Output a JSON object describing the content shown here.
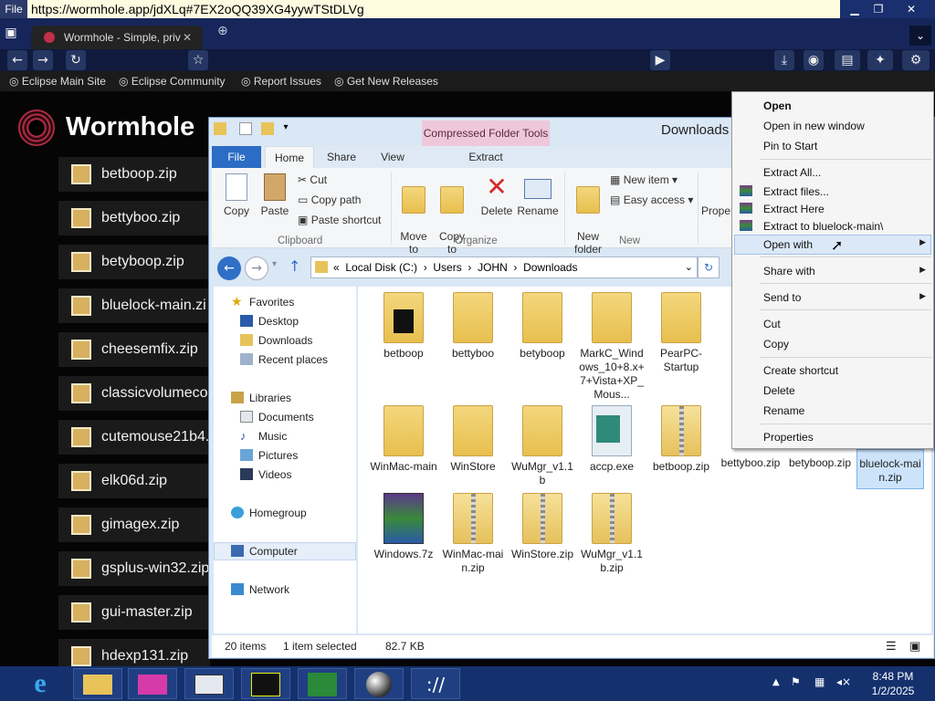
{
  "browser": {
    "file_menu": "File",
    "url": "https://wormhole.app/jdXLq#7EX2oQQ39XG4yywTStDLVg",
    "tab_title": "Wormhole - Simple, priv",
    "bookmarks": [
      "Eclipse Main Site",
      "Eclipse Community",
      "Report Issues",
      "Get New Releases"
    ]
  },
  "page": {
    "site_title": "Wormhole",
    "files": [
      "betboop.zip",
      "bettyboo.zip",
      "betyboop.zip",
      "bluelock-main.zi",
      "cheesemfix.zip",
      "classicvolumeco",
      "cutemouse21b4.",
      "elk06d.zip",
      "gimagex.zip",
      "gsplus-win32.zip",
      "gui-master.zip",
      "hdexp131.zip"
    ]
  },
  "explorer": {
    "title": "Downloads",
    "context_tab": "Compressed Folder Tools",
    "tabs": [
      "File",
      "Home",
      "Share",
      "View",
      "Extract"
    ],
    "ribbon": {
      "copy": "Copy",
      "paste": "Paste",
      "cut": "Cut",
      "copy_path": "Copy path",
      "paste_shortcut": "Paste shortcut",
      "clipboard": "Clipboard",
      "move_to": "Move\nto",
      "copy_to": "Copy\nto",
      "delete": "Delete",
      "rename": "Rename",
      "organize": "Organize",
      "new_folder": "New\nfolder",
      "new_item": "New item",
      "easy_access": "Easy access",
      "new": "New",
      "properties": "Prope"
    },
    "address": {
      "chevron": "«",
      "parts": [
        "Local Disk (C:)",
        "Users",
        "JOHN",
        "Downloads"
      ]
    },
    "nav": {
      "favorites": "Favorites",
      "favorites_items": [
        "Desktop",
        "Downloads",
        "Recent places"
      ],
      "libraries": "Libraries",
      "libraries_items": [
        "Documents",
        "Music",
        "Pictures",
        "Videos"
      ],
      "homegroup": "Homegroup",
      "computer": "Computer",
      "network": "Network"
    },
    "items": [
      {
        "name": "betboop",
        "type": "folder"
      },
      {
        "name": "bettyboo",
        "type": "folder"
      },
      {
        "name": "betyboop",
        "type": "folder"
      },
      {
        "name": "MarkC_Windows_10+8.x+7+Vista+XP_Mous...",
        "type": "folder"
      },
      {
        "name": "PearPC-Startup",
        "type": "folder"
      },
      {
        "name": "WinMac-main",
        "type": "folder"
      },
      {
        "name": "WinStore",
        "type": "folder"
      },
      {
        "name": "WuMgr_v1.1b",
        "type": "folder"
      },
      {
        "name": "accp.exe",
        "type": "exe"
      },
      {
        "name": "betboop.zip",
        "type": "zip"
      },
      {
        "name": "bettyboo.zip",
        "type": "zip"
      },
      {
        "name": "betyboop.zip",
        "type": "zip"
      },
      {
        "name": "bluelock-main.zip",
        "type": "zip"
      },
      {
        "name": "Windows.7z",
        "type": "7z"
      },
      {
        "name": "WinMac-main.zip",
        "type": "zip"
      },
      {
        "name": "WinStore.zip",
        "type": "zip"
      },
      {
        "name": "WuMgr_v1.1b.zip",
        "type": "zip"
      }
    ],
    "status": {
      "count": "20 items",
      "selected": "1 item selected",
      "size": "82.7 KB"
    }
  },
  "context_menu": {
    "items": [
      {
        "label": "Open",
        "bold": true
      },
      {
        "label": "Open in new window"
      },
      {
        "label": "Pin to Start"
      },
      {
        "label": "Extract All..."
      },
      {
        "label": "Extract files..."
      },
      {
        "label": "Extract Here"
      },
      {
        "label": "Extract to bluelock-main\\"
      },
      {
        "label": "Open with"
      },
      {
        "label": "Share with"
      },
      {
        "label": "Send to"
      },
      {
        "label": "Cut"
      },
      {
        "label": "Copy"
      },
      {
        "label": "Create shortcut"
      },
      {
        "label": "Delete"
      },
      {
        "label": "Rename"
      },
      {
        "label": "Properties"
      }
    ]
  },
  "taskbar": {
    "time": "8:48 PM",
    "date": "1/2/2025"
  }
}
